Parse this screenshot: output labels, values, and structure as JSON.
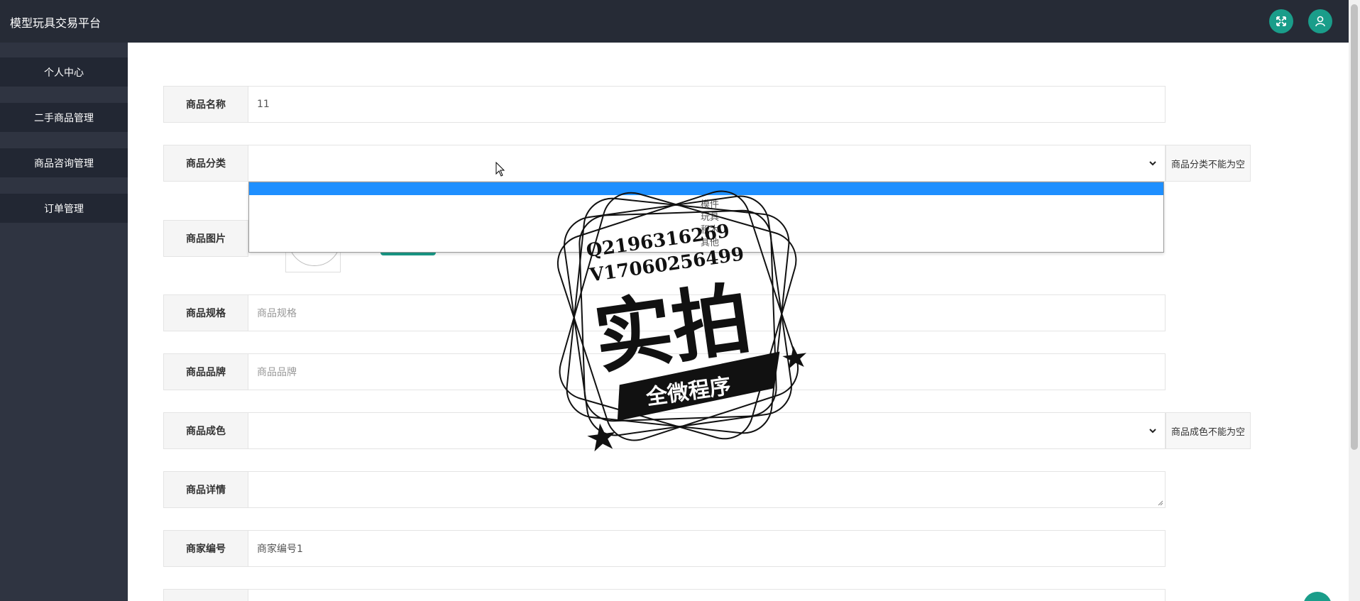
{
  "app": {
    "title": "模型玩具交易平台"
  },
  "header": {
    "fullscreen_icon": "fullscreen-icon",
    "user_icon": "user-icon"
  },
  "sidebar": {
    "items": [
      {
        "label": "个人中心"
      },
      {
        "label": "二手商品管理"
      },
      {
        "label": "商品咨询管理"
      },
      {
        "label": "订单管理"
      }
    ]
  },
  "form": {
    "name": {
      "label": "商品名称",
      "value": "11"
    },
    "category": {
      "label": "商品分类",
      "value": "",
      "error": "商品分类不能为空",
      "options": [
        "模件",
        "玩具",
        "积木",
        "其他"
      ]
    },
    "image": {
      "label": "商品图片"
    },
    "spec": {
      "label": "商品规格",
      "placeholder": "商品规格"
    },
    "brand": {
      "label": "商品品牌",
      "placeholder": "商品品牌"
    },
    "condition": {
      "label": "商品成色",
      "value": "",
      "error": "商品成色不能为空"
    },
    "details": {
      "label": "商品详情",
      "value": ""
    },
    "merchant": {
      "label": "商家编号",
      "value": "商家编号1"
    }
  },
  "watermark": {
    "line1": "Q2196316269",
    "line2": "V17060256499",
    "big": "实拍",
    "banner": "全微程序"
  },
  "colors": {
    "topbar": "#262b36",
    "sidebar": "#2f3441",
    "accent": "#1a9d8a",
    "select_highlight": "#1e8fff"
  }
}
